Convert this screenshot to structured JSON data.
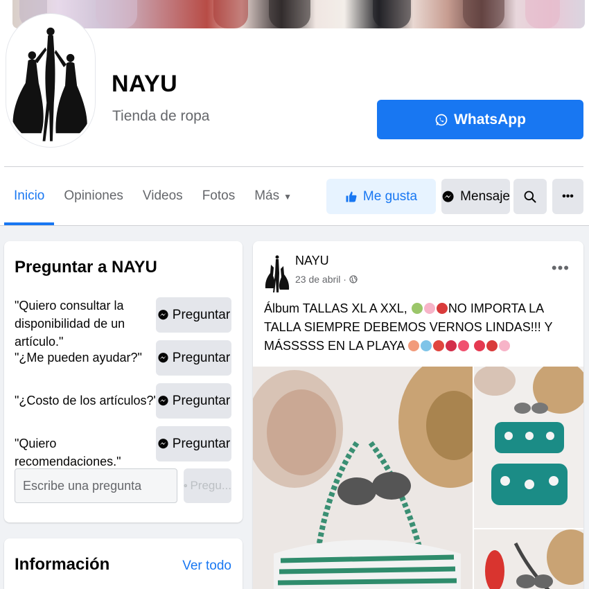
{
  "page": {
    "name": "NAYU",
    "category": "Tienda de ropa",
    "whatsapp_label": "WhatsApp"
  },
  "tabs": [
    {
      "label": "Inicio",
      "active": true
    },
    {
      "label": "Opiniones"
    },
    {
      "label": "Videos"
    },
    {
      "label": "Fotos"
    },
    {
      "label": "Más"
    }
  ],
  "actions": {
    "like_label": "Me gusta",
    "message_label": "Mensaje",
    "search_icon": "search-icon",
    "more_icon": "ellipsis-icon"
  },
  "ask": {
    "title": "Preguntar a NAYU",
    "questions": [
      {
        "text": "\"Quiero consultar la disponibilidad de un artículo.\"",
        "button": "Preguntar"
      },
      {
        "text": "\"¿Me pueden ayudar?\"",
        "button": "Preguntar"
      },
      {
        "text": "\"¿Costo de los artículos?\"",
        "button": "Preguntar"
      },
      {
        "text": "\"Quiero recomendaciones.\"",
        "button": "Preguntar"
      }
    ],
    "input_placeholder": "Escribe una pregunta",
    "send_label": "Pregu..."
  },
  "info": {
    "title": "Información",
    "see_all": "Ver todo"
  },
  "post": {
    "author": "NAYU",
    "date": "23 de abril ·",
    "text_part1": "Álbum TALLAS XL A XXL,",
    "text_part2": "NO IMPORTA LA TALLA SIEMPRE DEBEMOS VERNOS LINDAS!!! Y MÁSSSSS EN LA PLAYA",
    "more_label": "•••"
  },
  "colors": {
    "brand": "#1877f2",
    "like_bg": "#e7f3ff",
    "button_gray": "#e4e6eb",
    "page_bg": "#f0f2f5",
    "secondary_text": "#65676b"
  }
}
